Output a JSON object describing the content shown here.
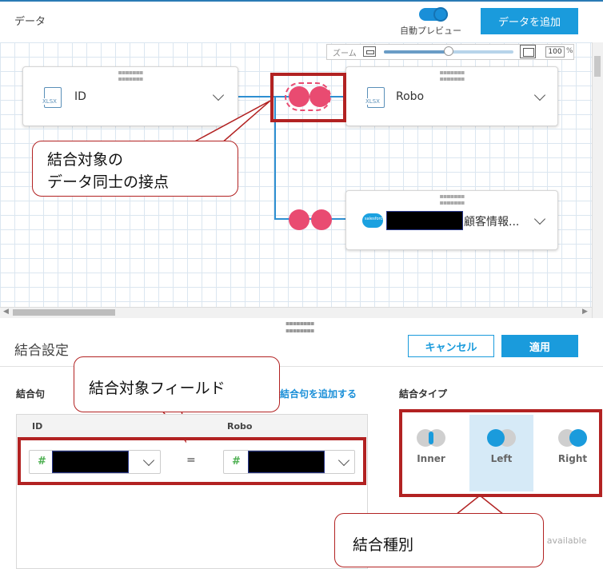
{
  "header": {
    "title": "データ",
    "auto_preview_label": "自動プレビュー",
    "add_data_button": "データを追加"
  },
  "zoom": {
    "label": "ズーム",
    "value": "100",
    "unit": "%"
  },
  "canvas": {
    "nodes": [
      {
        "label": "ID",
        "icon": "xlsx-file-icon",
        "icon_text": "XLSX"
      },
      {
        "label": "Robo",
        "icon": "xlsx-file-icon",
        "icon_text": "XLSX"
      },
      {
        "label": "顧客情報...",
        "icon": "salesforce-icon",
        "icon_text": "salesforce"
      }
    ]
  },
  "annotations": {
    "connection_point": [
      "結合対象の",
      "データ同士の接点"
    ],
    "target_field": "結合対象フィールド",
    "join_kind": "結合種別"
  },
  "join_settings": {
    "title": "結合設定",
    "cancel_button": "キャンセル",
    "apply_button": "適用",
    "clause_label": "結合句",
    "add_clause_link": "結合句を追加する",
    "left_column_header": "ID",
    "right_column_header": "Robo",
    "equals": "=",
    "field_type_symbol": "#",
    "join_type_label": "結合タイプ",
    "join_types": [
      "Inner",
      "Left",
      "Right"
    ],
    "selected_join_type": "Left",
    "unavailable_text": "t available"
  },
  "colors": {
    "accent": "#1a9bdc",
    "node_dot": "#e94b71",
    "annotation_red": "#b22222"
  }
}
